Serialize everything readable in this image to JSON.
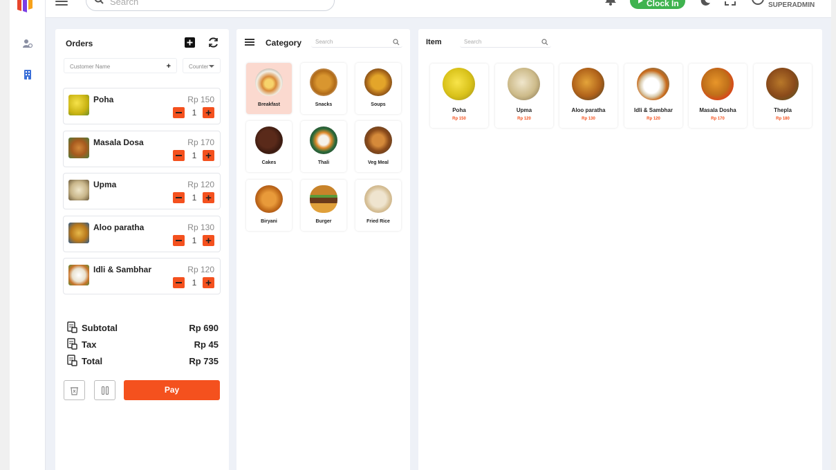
{
  "app": {
    "search_placeholder": "Search",
    "clock_in_label": "Clock In",
    "username": "SUPERADMIN",
    "colors": {
      "accent": "#f4511e",
      "green": "#3fb34f"
    }
  },
  "orders": {
    "title": "Orders",
    "customer_placeholder": "Customer Name",
    "customer_add": "+",
    "counter_label": "Counter",
    "items": [
      {
        "name": "Poha",
        "price": "Rp 150",
        "qty": "1"
      },
      {
        "name": "Masala Dosa",
        "price": "Rp 170",
        "qty": "1"
      },
      {
        "name": "Upma",
        "price": "Rp 120",
        "qty": "1"
      },
      {
        "name": "Aloo paratha",
        "price": "Rp 130",
        "qty": "1"
      },
      {
        "name": "Idli & Sambhar",
        "price": "Rp 120",
        "qty": "1"
      }
    ],
    "summary": {
      "subtotal_label": "Subtotal",
      "subtotal": "Rp 690",
      "tax_label": "Tax",
      "tax": "Rp 45",
      "total_label": "Total",
      "total": "Rp 735"
    },
    "pay_label": "Pay"
  },
  "category": {
    "title": "Category",
    "search_placeholder": "Search",
    "items": [
      {
        "label": "Breakfast",
        "active": true
      },
      {
        "label": "Snacks"
      },
      {
        "label": "Soups"
      },
      {
        "label": "Cakes"
      },
      {
        "label": "Thali"
      },
      {
        "label": "Veg Meal"
      },
      {
        "label": "Biryani"
      },
      {
        "label": "Burger"
      },
      {
        "label": "Fried Rice"
      }
    ]
  },
  "items": {
    "title": "Item",
    "search_placeholder": "Search",
    "products": [
      {
        "name": "Poha",
        "price": "Rp 150"
      },
      {
        "name": "Upma",
        "price": "Rp 120"
      },
      {
        "name": "Aloo paratha",
        "price": "Rp 130"
      },
      {
        "name": "Idli & Sambhar",
        "price": "Rp 120"
      },
      {
        "name": "Masala Dosha",
        "price": "Rp 170"
      },
      {
        "name": "Thepla",
        "price": "Rp 180"
      }
    ]
  }
}
